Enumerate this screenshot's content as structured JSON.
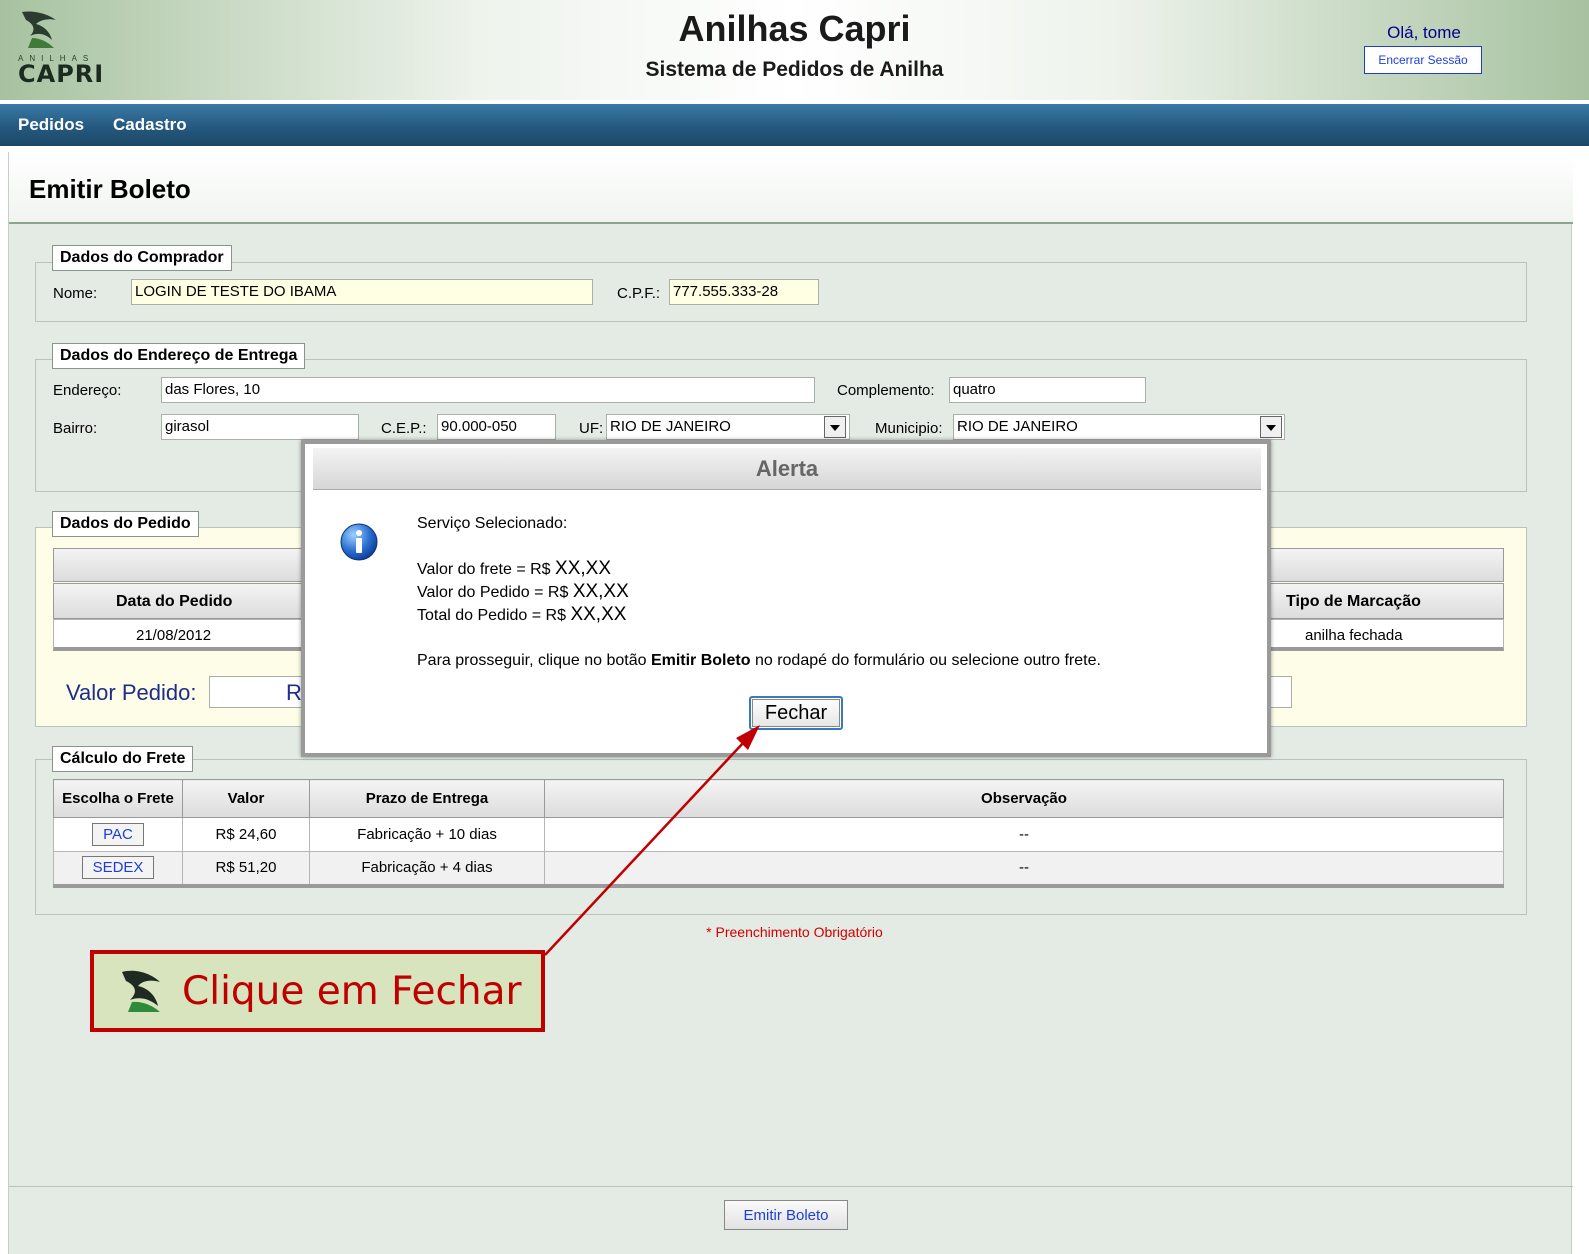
{
  "header": {
    "logo_small_text": "ANILHAS",
    "logo_text": "CAPRI",
    "title": "Anilhas Capri",
    "subtitle": "Sistema de Pedidos de Anilha",
    "greeting": "Olá, tome",
    "logout_label": "Encerrar Sessão"
  },
  "nav": {
    "items": [
      "Pedidos",
      "Cadastro"
    ]
  },
  "page": {
    "title": "Emitir Boleto"
  },
  "comprador": {
    "legend": "Dados do Comprador",
    "nome_label": "Nome:",
    "nome_value": "LOGIN DE TESTE DO IBAMA",
    "cpf_label": "C.P.F.:",
    "cpf_value": "777.555.333-28"
  },
  "endereco": {
    "legend": "Dados do Endereço de Entrega",
    "endereco_label": "Endereço:",
    "endereco_value": "das Flores, 10",
    "complemento_label": "Complemento:",
    "complemento_value": "quatro",
    "bairro_label": "Bairro:",
    "bairro_value": "girasol",
    "cep_label": "C.E.P.:",
    "cep_value": "90.000-050",
    "uf_label": "UF:",
    "uf_value": "RIO DE JANEIRO",
    "municipio_label": "Municipio:",
    "municipio_value": "RIO DE JANEIRO"
  },
  "pedido": {
    "legend": "Dados do Pedido",
    "headers": [
      "Data do Pedido",
      "Tipo de Marcação"
    ],
    "row": [
      "21/08/2012",
      "anilha fechada"
    ],
    "valor_label": "Valor Pedido:",
    "valor_partial": "R"
  },
  "frete": {
    "legend": "Cálculo do Frete",
    "headers": [
      "Escolha o Frete",
      "Valor",
      "Prazo de Entrega",
      "Observação"
    ],
    "rows": [
      {
        "service": "PAC",
        "valor": "R$ 24,60",
        "prazo": "Fabricação + 10 dias",
        "obs": "--"
      },
      {
        "service": "SEDEX",
        "valor": "R$ 51,20",
        "prazo": "Fabricação + 4 dias",
        "obs": "--"
      }
    ]
  },
  "required_note": "* Preenchimento Obrigatório",
  "footer": {
    "emitir_label": "Emitir Boleto"
  },
  "modal": {
    "title": "Alerta",
    "line1": "Serviço Selecionado:",
    "frete_label": "Valor do frete = R$",
    "frete_value": "XX,XX",
    "pedido_label": "Valor do Pedido = R$",
    "pedido_value": "XX,XX",
    "total_label": "Total do Pedido = R$",
    "total_value": "XX,XX",
    "instr_before": "Para prosseguir, clique no botão ",
    "instr_bold": "Emitir Boleto",
    "instr_after": " no rodapé do formulário ou selecione outro frete.",
    "close_label": "Fechar"
  },
  "callout": {
    "text": "Clique em Fechar"
  },
  "colors": {
    "nav": "#25597f",
    "callout_bg": "#d7e4bd",
    "callout_border": "#c00000",
    "link": "#1e3fd6"
  }
}
